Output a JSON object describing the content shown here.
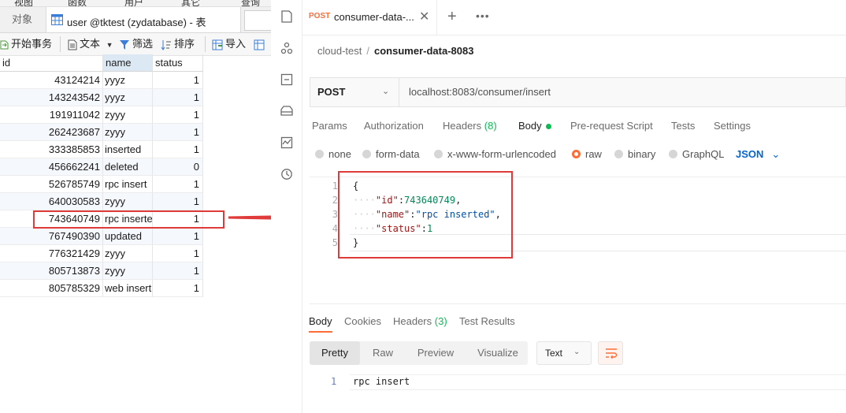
{
  "db": {
    "menu": [
      "视图",
      "函数",
      "用户",
      "其它",
      "查询"
    ],
    "tab_objects": "对象",
    "tab_table": "user @tktest (zydatabase) - 表",
    "toolbar": {
      "begin_tx": "开始事务",
      "text": "文本",
      "filter": "筛选",
      "sort": "排序",
      "import": "导入"
    },
    "columns": [
      "id",
      "name",
      "status"
    ],
    "rows": [
      {
        "id": "43124214",
        "name": "yyyz",
        "status": "1"
      },
      {
        "id": "143243542",
        "name": "yyyz",
        "status": "1"
      },
      {
        "id": "191911042",
        "name": "zyyy",
        "status": "1"
      },
      {
        "id": "262423687",
        "name": "zyyy",
        "status": "1"
      },
      {
        "id": "333385853",
        "name": "inserted",
        "status": "1"
      },
      {
        "id": "456662241",
        "name": "deleted",
        "status": "0"
      },
      {
        "id": "526785749",
        "name": "rpc insert",
        "status": "1"
      },
      {
        "id": "640030583",
        "name": "zyyy",
        "status": "1"
      },
      {
        "id": "743640749",
        "name": "rpc inserte",
        "status": "1"
      },
      {
        "id": "767490390",
        "name": "updated",
        "status": "1"
      },
      {
        "id": "776321429",
        "name": "zyyy",
        "status": "1"
      },
      {
        "id": "805713873",
        "name": "zyyy",
        "status": "1"
      },
      {
        "id": "805785329",
        "name": "web insert",
        "status": "1"
      }
    ]
  },
  "postman": {
    "tab": {
      "method": "POST",
      "name": "consumer-data-..."
    },
    "breadcrumb": {
      "parent": "cloud-test",
      "sep": "/",
      "current": "consumer-data-8083"
    },
    "method": "POST",
    "url": "localhost:8083/consumer/insert",
    "request_tabs": {
      "params": "Params",
      "authorization": "Authorization",
      "headers": "Headers",
      "headers_count": "(8)",
      "body": "Body",
      "pre_request": "Pre-request Script",
      "tests": "Tests",
      "settings": "Settings"
    },
    "body_types": {
      "none": "none",
      "form_data": "form-data",
      "urlencoded": "x-www-form-urlencoded",
      "raw": "raw",
      "binary": "binary",
      "graphql": "GraphQL",
      "json": "JSON"
    },
    "code": {
      "line_numbers": [
        "1",
        "2",
        "3",
        "4",
        "5"
      ],
      "open": "{",
      "k1": "\"id\"",
      "v1": "743640749",
      "k2": "\"name\"",
      "v2": "\"rpc inserted\"",
      "k3": "\"status\"",
      "v3": "1",
      "close": "}"
    },
    "response_tabs": {
      "body": "Body",
      "cookies": "Cookies",
      "headers": "Headers",
      "headers_count": "(3)",
      "test_results": "Test Results"
    },
    "view_modes": {
      "pretty": "Pretty",
      "raw": "Raw",
      "preview": "Preview",
      "visualize": "Visualize"
    },
    "format": "Text",
    "response": {
      "line": "1",
      "text": "rpc insert"
    },
    "colors": {
      "accent": "#ff6c37",
      "green": "#0cbb52",
      "link": "#0265d2",
      "highlight": "#e03a3a"
    }
  }
}
